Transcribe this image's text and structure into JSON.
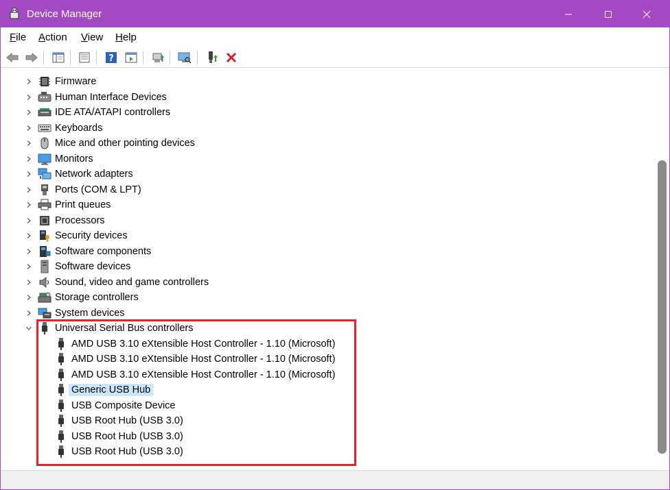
{
  "window": {
    "title": "Device Manager",
    "accent_color": "#a349c1",
    "controls": [
      "minimize-icon",
      "maximize-icon",
      "close-icon"
    ]
  },
  "menu": {
    "file": "File",
    "action": "Action",
    "view": "View",
    "help": "Help"
  },
  "toolbar": {
    "buttons": [
      "back-arrow-icon",
      "forward-arrow-icon",
      "show-hide-tree-icon",
      "properties-icon",
      "help-icon",
      "action-pane-icon",
      "update-driver-icon",
      "scan-hardware-icon",
      "enable-device-icon",
      "uninstall-device-icon"
    ]
  },
  "tree": {
    "categories": [
      {
        "label": "Firmware",
        "icon": "firmware-icon"
      },
      {
        "label": "Human Interface Devices",
        "icon": "hid-icon"
      },
      {
        "label": "IDE ATA/ATAPI controllers",
        "icon": "ide-icon"
      },
      {
        "label": "Keyboards",
        "icon": "keyboard-icon"
      },
      {
        "label": "Mice and other pointing devices",
        "icon": "mouse-icon"
      },
      {
        "label": "Monitors",
        "icon": "monitor-icon"
      },
      {
        "label": "Network adapters",
        "icon": "network-icon"
      },
      {
        "label": "Ports (COM & LPT)",
        "icon": "port-icon"
      },
      {
        "label": "Print queues",
        "icon": "printer-icon"
      },
      {
        "label": "Processors",
        "icon": "processor-icon"
      },
      {
        "label": "Security devices",
        "icon": "security-icon"
      },
      {
        "label": "Software components",
        "icon": "software-components-icon"
      },
      {
        "label": "Software devices",
        "icon": "software-devices-icon"
      },
      {
        "label": "Sound, video and game controllers",
        "icon": "speaker-icon"
      },
      {
        "label": "Storage controllers",
        "icon": "storage-icon"
      },
      {
        "label": "System devices",
        "icon": "system-icon"
      }
    ],
    "usb": {
      "label": "Universal Serial Bus controllers",
      "icon": "usb-icon",
      "expanded": true,
      "children": [
        {
          "label": "AMD USB 3.10 eXtensible Host Controller - 1.10 (Microsoft)"
        },
        {
          "label": "AMD USB 3.10 eXtensible Host Controller - 1.10 (Microsoft)"
        },
        {
          "label": "AMD USB 3.10 eXtensible Host Controller - 1.10 (Microsoft)"
        },
        {
          "label": "Generic USB Hub",
          "selected": true
        },
        {
          "label": "USB Composite Device"
        },
        {
          "label": "USB Root Hub (USB 3.0)"
        },
        {
          "label": "USB Root Hub (USB 3.0)"
        },
        {
          "label": "USB Root Hub (USB 3.0)"
        }
      ]
    }
  },
  "highlight_color": "#e3222b",
  "selection_color": "#cce8ff"
}
